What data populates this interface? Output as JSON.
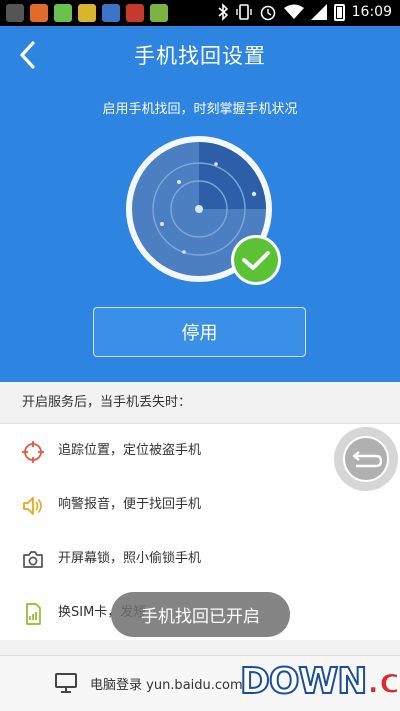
{
  "status_bar": {
    "time": "16:09"
  },
  "header": {
    "title": "手机找回设置",
    "subtitle": "启用手机找回，时刻掌握手机状况"
  },
  "stop_button_label": "停用",
  "section": {
    "title": "开启服务后，当手机丢失时："
  },
  "features": [
    {
      "label": "追踪位置，定位被盗手机",
      "icon": "target-icon",
      "color": "#e8563f"
    },
    {
      "label": "响警报音，便于找回手机",
      "icon": "speaker-icon",
      "color": "#e8a81a"
    },
    {
      "label": "开屏幕锁，照小偷锁手机",
      "icon": "camera-icon",
      "color": "#555555"
    },
    {
      "label": "换SIM卡，发短",
      "icon": "sim-card-icon",
      "color": "#8bbd2d"
    }
  ],
  "toast": "手机找回已开启",
  "bottom": {
    "text": "电脑登录 yun.baidu.com"
  },
  "watermark": {
    "main": "DOWN",
    "suffix": ".cc"
  },
  "colors": {
    "primary": "#2d85e1",
    "check": "#5bc236"
  }
}
